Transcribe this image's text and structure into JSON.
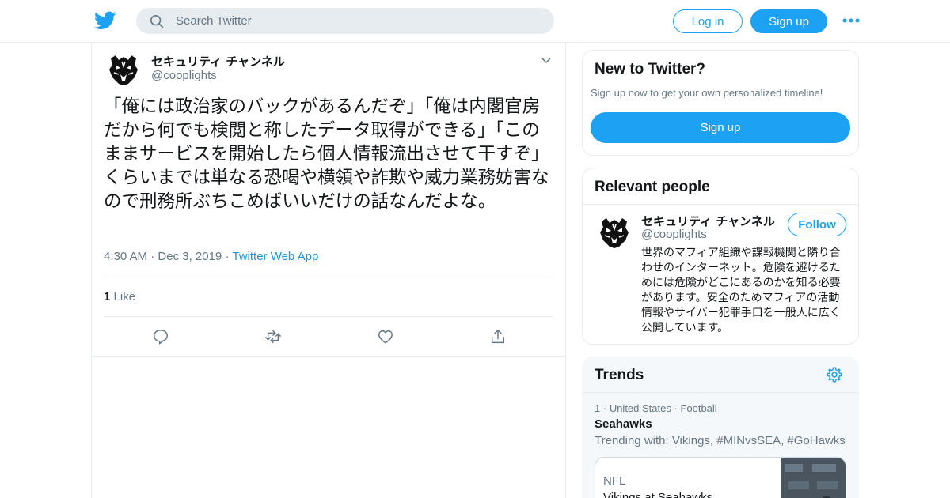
{
  "colors": {
    "brand": "#1da1f2",
    "link": "#1b95e0",
    "muted": "#657786",
    "text": "#14171a",
    "border": "#e6ecf0"
  },
  "header": {
    "logo_icon": "twitter-bird-icon",
    "search_placeholder": "Search Twitter",
    "login_label": "Log in",
    "signup_label": "Sign up",
    "more_icon": "more-dots-icon"
  },
  "tweet": {
    "author_name": "セキュリティ チャンネル",
    "author_handle": "@cooplights",
    "text": "「俺には政治家のバックがあるんだぞ」「俺は内閣官房だから何でも検閲と称したデータ取得ができる」「このままサービスを開始したら個人情報流出させて干すぞ」くらいまでは単なる恐喝や横領や詐欺や威力業務妨害なので刑務所ぶちこめばいいだけの話なんだよな。",
    "time": "4:30 AM",
    "date": "Dec 3, 2019",
    "source": "Twitter Web App",
    "like_count": "1",
    "like_label": "Like",
    "actions": [
      "reply-icon",
      "retweet-icon",
      "like-icon",
      "share-icon"
    ]
  },
  "new_to_twitter": {
    "title": "New to Twitter?",
    "subtitle": "Sign up now to get your own personalized timeline!",
    "button_label": "Sign up"
  },
  "relevant_people": {
    "title": "Relevant people",
    "person": {
      "name": "セキュリティ チャンネル",
      "handle": "@cooplights",
      "follow_label": "Follow",
      "bio": "世界のマフィア組織や諜報機関と隣り合わせのインターネット。危険を避けるためには危険がどこにあるのかを知る必要があります。安全のためマフィアの活動情報やサイバー犯罪手口を一般人に広く公開しています。"
    }
  },
  "trends": {
    "title": "Trends",
    "items": [
      {
        "rank": "1",
        "location": "United States",
        "category": "Football",
        "name": "Seahawks",
        "trending_with": "Trending with: Vikings, #MINvsSEA, #GoHawks",
        "news_category": "NFL",
        "news_title": "Vikings at Seahawks"
      }
    ]
  }
}
